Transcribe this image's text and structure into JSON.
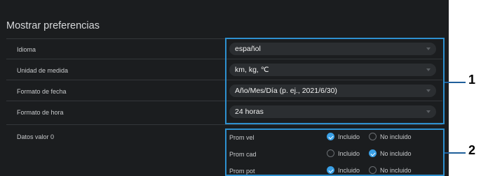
{
  "section": {
    "title": "Mostrar preferencias"
  },
  "settings": [
    {
      "label": "Idioma",
      "value": "español"
    },
    {
      "label": "Unidad de medida",
      "value": "km, kg, ℃"
    },
    {
      "label": "Formato de fecha",
      "value": "Año/Mes/Día (p. ej., 2021/6/30)"
    },
    {
      "label": "Formato de hora",
      "value": "24 horas"
    }
  ],
  "zero_data": {
    "label": "Datos valor 0",
    "included_label": "Incluido",
    "not_included_label": "No incluido",
    "rows": [
      {
        "label": "Prom vel",
        "selected": "included"
      },
      {
        "label": "Prom cad",
        "selected": "not_included"
      },
      {
        "label": "Prom pot",
        "selected": "included"
      }
    ]
  },
  "callouts": [
    "1",
    "2"
  ],
  "colors": {
    "panel": "#1b1d1f",
    "highlight": "#2e90cf",
    "accent": "#3aa0e6"
  }
}
